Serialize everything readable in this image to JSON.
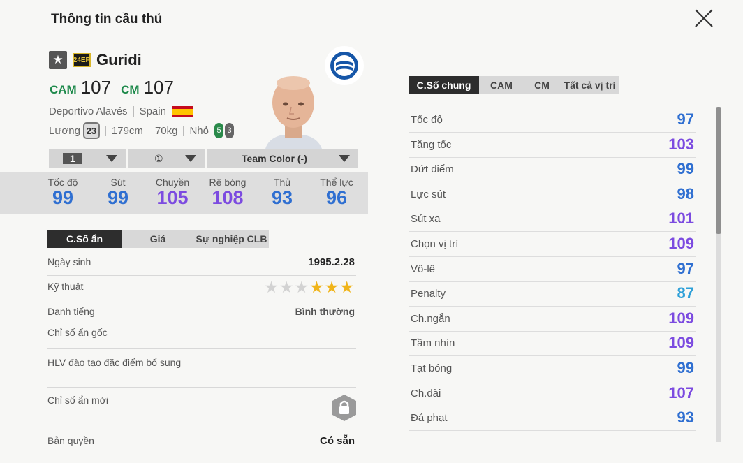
{
  "title": "Thông tin cầu thủ",
  "player": {
    "season_badge": "24EP",
    "name": "Guridi",
    "positions": [
      {
        "pos": "CAM",
        "ovr": "107"
      },
      {
        "pos": "CM",
        "ovr": "107"
      }
    ],
    "club": "Deportivo Alavés",
    "nation": "Spain",
    "salary_label": "Lương",
    "salary": "23",
    "height": "179cm",
    "weight": "70kg",
    "body": "Nhỏ",
    "weak_foot": "5",
    "strong_foot": "3"
  },
  "selectors": {
    "level": "1",
    "upgrade": "①",
    "team_color": "Team Color (-)"
  },
  "main_stats": [
    {
      "label": "Tốc độ",
      "value": "99",
      "color": "#2f6fd1"
    },
    {
      "label": "Sút",
      "value": "99",
      "color": "#2f6fd1"
    },
    {
      "label": "Chuyền",
      "value": "105",
      "color": "#7c4be0"
    },
    {
      "label": "Rê bóng",
      "value": "108",
      "color": "#7c4be0"
    },
    {
      "label": "Thủ",
      "value": "93",
      "color": "#2f6fd1"
    },
    {
      "label": "Thể lực",
      "value": "96",
      "color": "#2f6fd1"
    }
  ],
  "left_tabs": [
    "C.Số ẩn",
    "Giá",
    "Sự nghiệp CLB"
  ],
  "hidden": {
    "birth_label": "Ngày sinh",
    "birth": "1995.2.28",
    "skill_label": "Kỹ thuật",
    "skill_stars": 3,
    "skill_max": 6,
    "rep_label": "Danh tiếng",
    "rep": "Bình thường",
    "orig_label": "Chỉ số ẩn gốc",
    "coach_label": "HLV đào tạo đặc điểm bổ sung",
    "new_label": "Chỉ số ẩn mới",
    "copyright_label": "Bản quyền",
    "copyright": "Có sẵn"
  },
  "right_tabs": [
    "C.Số chung",
    "CAM",
    "CM",
    "Tất cả vị trí"
  ],
  "attributes": [
    {
      "name": "Tốc độ",
      "value": "97",
      "color": "#2f6fd1"
    },
    {
      "name": "Tăng tốc",
      "value": "103",
      "color": "#7c4be0"
    },
    {
      "name": "Dứt điểm",
      "value": "99",
      "color": "#2f6fd1"
    },
    {
      "name": "Lực sút",
      "value": "98",
      "color": "#2f6fd1"
    },
    {
      "name": "Sút xa",
      "value": "101",
      "color": "#7c4be0"
    },
    {
      "name": "Chọn vị trí",
      "value": "109",
      "color": "#7c4be0"
    },
    {
      "name": "Vô-lê",
      "value": "97",
      "color": "#2f6fd1"
    },
    {
      "name": "Penalty",
      "value": "87",
      "color": "#2ea0d8"
    },
    {
      "name": "Ch.ngắn",
      "value": "109",
      "color": "#7c4be0"
    },
    {
      "name": "Tầm nhìn",
      "value": "109",
      "color": "#7c4be0"
    },
    {
      "name": "Tạt bóng",
      "value": "99",
      "color": "#2f6fd1"
    },
    {
      "name": "Ch.dài",
      "value": "107",
      "color": "#7c4be0"
    },
    {
      "name": "Đá phạt",
      "value": "93",
      "color": "#2f6fd1"
    }
  ]
}
